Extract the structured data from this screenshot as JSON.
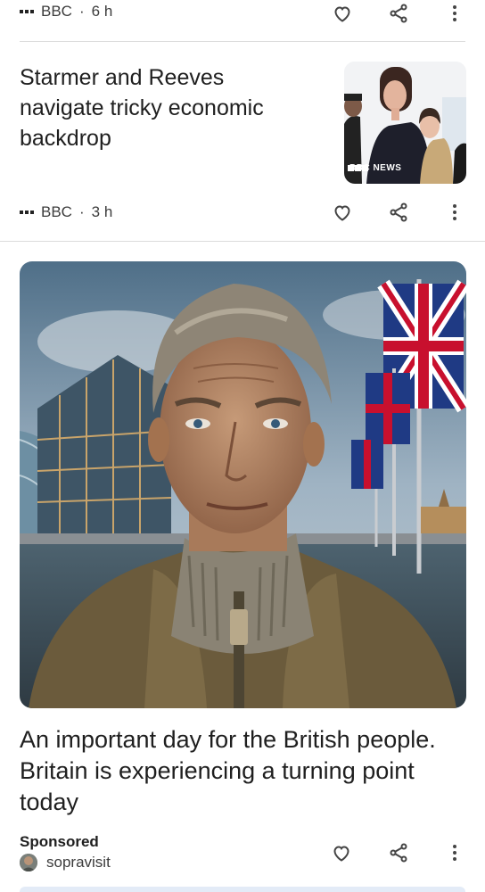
{
  "top_card": {
    "source": "BBC",
    "time": "6 h"
  },
  "article1": {
    "headline": "Starmer and Reeves navigate tricky economic backdrop",
    "source": "BBC",
    "time": "3 h",
    "thumb_watermark": "BBC NEWS"
  },
  "article2": {
    "headline": "An important day for the British people. Britain is experiencing a turning point today",
    "sponsored_label": "Sponsored",
    "advertiser": "sopravisit"
  },
  "separator": "·",
  "icons": {
    "like": "heart-icon",
    "share": "share-icon",
    "more": "more-vert-icon"
  },
  "colors": {
    "divider": "#dcdcdc",
    "text": "#1f1f1f",
    "icon": "#444444"
  }
}
